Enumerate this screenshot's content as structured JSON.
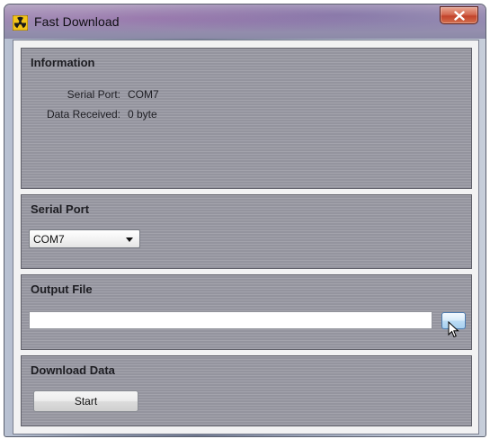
{
  "window": {
    "title": "Fast Download",
    "icon": "radiation-icon",
    "close_icon": "close-icon"
  },
  "information": {
    "title": "Information",
    "rows": [
      {
        "label": "Serial Port:",
        "value": "COM7"
      },
      {
        "label": "Data Received:",
        "value": "0 byte"
      }
    ]
  },
  "serial_port": {
    "title": "Serial Port",
    "selected": "COM7"
  },
  "output_file": {
    "title": "Output File",
    "value": ""
  },
  "download_data": {
    "title": "Download Data",
    "start_label": "Start"
  }
}
